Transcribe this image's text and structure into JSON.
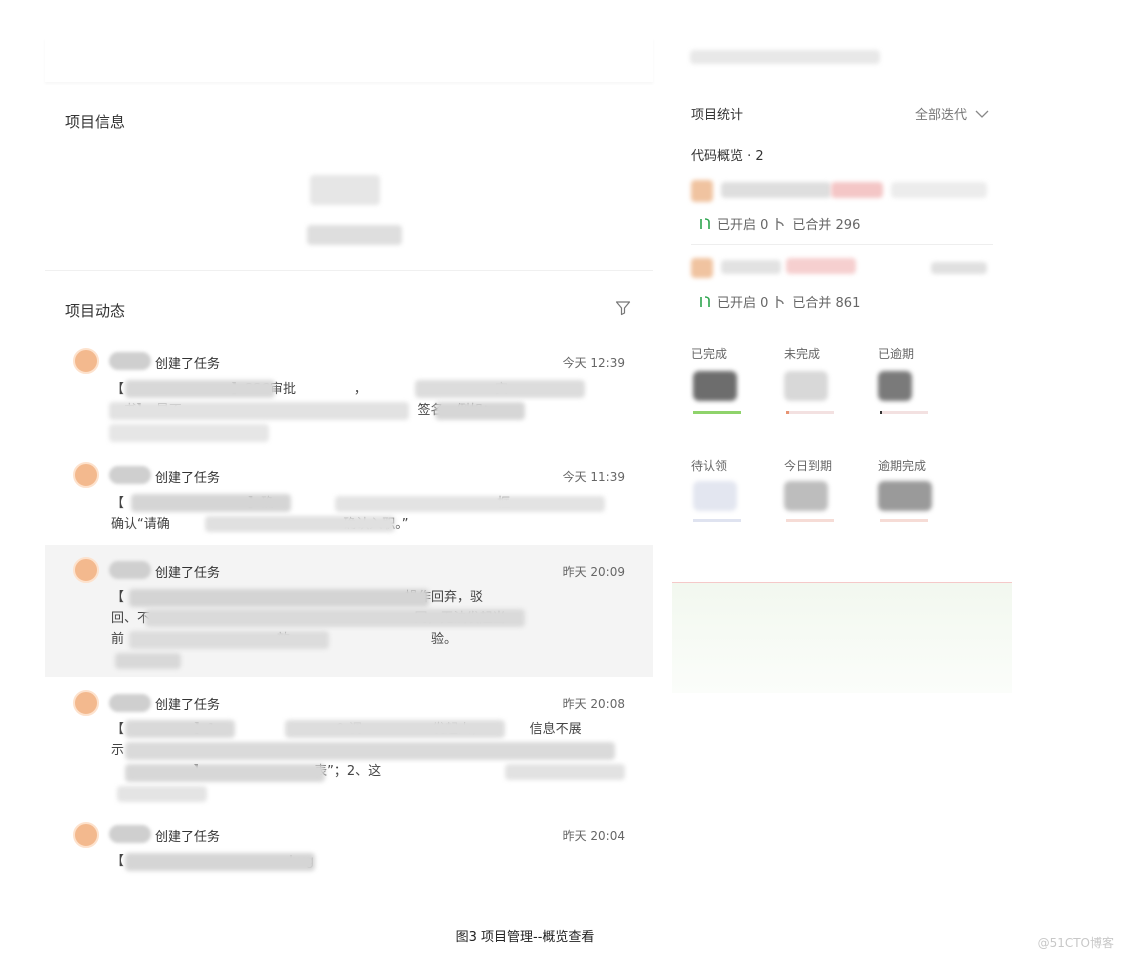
{
  "info": {
    "title": "项目信息"
  },
  "activity": {
    "title": "项目动态",
    "filter_icon": "filter-icon",
    "items": [
      {
        "action": "创建了任务",
        "time": "今天 12:39",
        "lines": [
          "【                          】SSC审批              ，                               实",
          "   书】，是不                                                         签名，例如：",
          "          "
        ]
      },
      {
        "action": "创建了任务",
        "time": "今天 11:39",
        "lines": [
          "【                              】确                                                      框",
          "确认“请确                                          确认入职。”",
          ""
        ]
      },
      {
        "action": "创建了任务",
        "time": "昨天 20:09",
        "lines": [
          "【                                                                    操作回弃，驳",
          "回、不                                                                同，无法发起当",
          "前                                     效，                               验。"
        ]
      },
      {
        "action": "创建了任务",
        "time": "昨天 20:08",
        "lines": [
          "【                 】1、                          0-调                 发起人，           信息不展",
          "示                                                                                    ",
          "                    】                          表”；2、这                  "
        ]
      },
      {
        "action": "创建了任务",
        "time": "昨天 20:04",
        "lines": [
          "【                                        bug"
        ]
      }
    ]
  },
  "stats": {
    "title": "项目统计",
    "iteration_select": "全部迭代",
    "code_overview": "代码概览 · 2",
    "repos": [
      {
        "opened": "已开启 0",
        "merged": "已合并 296"
      },
      {
        "opened": "已开启 0",
        "merged": "已合并 861"
      }
    ],
    "cards": [
      {
        "label": "已完成",
        "bar_color": "#8fd36b"
      },
      {
        "label": "未完成",
        "bar_color": "#f3d4d4"
      },
      {
        "label": "已逾期",
        "bar_color": "#f3d4d4"
      },
      {
        "label": "待认领",
        "bar_color": "#dfe3f0"
      },
      {
        "label": "今日到期",
        "bar_color": "#f6dcd6"
      },
      {
        "label": "逾期完成",
        "bar_color": "#f6dcd6"
      }
    ]
  },
  "caption": "图3 项目管理--概览查看",
  "watermark": "@51CTO博客"
}
